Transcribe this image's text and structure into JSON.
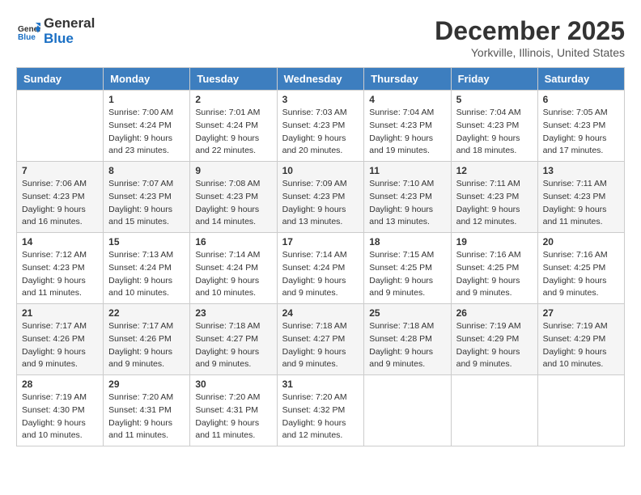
{
  "header": {
    "logo_general": "General",
    "logo_blue": "Blue",
    "month_title": "December 2025",
    "location": "Yorkville, Illinois, United States"
  },
  "columns": [
    "Sunday",
    "Monday",
    "Tuesday",
    "Wednesday",
    "Thursday",
    "Friday",
    "Saturday"
  ],
  "weeks": [
    [
      {
        "day": "",
        "info": ""
      },
      {
        "day": "1",
        "info": "Sunrise: 7:00 AM\nSunset: 4:24 PM\nDaylight: 9 hours\nand 23 minutes."
      },
      {
        "day": "2",
        "info": "Sunrise: 7:01 AM\nSunset: 4:24 PM\nDaylight: 9 hours\nand 22 minutes."
      },
      {
        "day": "3",
        "info": "Sunrise: 7:03 AM\nSunset: 4:23 PM\nDaylight: 9 hours\nand 20 minutes."
      },
      {
        "day": "4",
        "info": "Sunrise: 7:04 AM\nSunset: 4:23 PM\nDaylight: 9 hours\nand 19 minutes."
      },
      {
        "day": "5",
        "info": "Sunrise: 7:04 AM\nSunset: 4:23 PM\nDaylight: 9 hours\nand 18 minutes."
      },
      {
        "day": "6",
        "info": "Sunrise: 7:05 AM\nSunset: 4:23 PM\nDaylight: 9 hours\nand 17 minutes."
      }
    ],
    [
      {
        "day": "7",
        "info": "Sunrise: 7:06 AM\nSunset: 4:23 PM\nDaylight: 9 hours\nand 16 minutes."
      },
      {
        "day": "8",
        "info": "Sunrise: 7:07 AM\nSunset: 4:23 PM\nDaylight: 9 hours\nand 15 minutes."
      },
      {
        "day": "9",
        "info": "Sunrise: 7:08 AM\nSunset: 4:23 PM\nDaylight: 9 hours\nand 14 minutes."
      },
      {
        "day": "10",
        "info": "Sunrise: 7:09 AM\nSunset: 4:23 PM\nDaylight: 9 hours\nand 13 minutes."
      },
      {
        "day": "11",
        "info": "Sunrise: 7:10 AM\nSunset: 4:23 PM\nDaylight: 9 hours\nand 13 minutes."
      },
      {
        "day": "12",
        "info": "Sunrise: 7:11 AM\nSunset: 4:23 PM\nDaylight: 9 hours\nand 12 minutes."
      },
      {
        "day": "13",
        "info": "Sunrise: 7:11 AM\nSunset: 4:23 PM\nDaylight: 9 hours\nand 11 minutes."
      }
    ],
    [
      {
        "day": "14",
        "info": "Sunrise: 7:12 AM\nSunset: 4:23 PM\nDaylight: 9 hours\nand 11 minutes."
      },
      {
        "day": "15",
        "info": "Sunrise: 7:13 AM\nSunset: 4:24 PM\nDaylight: 9 hours\nand 10 minutes."
      },
      {
        "day": "16",
        "info": "Sunrise: 7:14 AM\nSunset: 4:24 PM\nDaylight: 9 hours\nand 10 minutes."
      },
      {
        "day": "17",
        "info": "Sunrise: 7:14 AM\nSunset: 4:24 PM\nDaylight: 9 hours\nand 9 minutes."
      },
      {
        "day": "18",
        "info": "Sunrise: 7:15 AM\nSunset: 4:25 PM\nDaylight: 9 hours\nand 9 minutes."
      },
      {
        "day": "19",
        "info": "Sunrise: 7:16 AM\nSunset: 4:25 PM\nDaylight: 9 hours\nand 9 minutes."
      },
      {
        "day": "20",
        "info": "Sunrise: 7:16 AM\nSunset: 4:25 PM\nDaylight: 9 hours\nand 9 minutes."
      }
    ],
    [
      {
        "day": "21",
        "info": "Sunrise: 7:17 AM\nSunset: 4:26 PM\nDaylight: 9 hours\nand 9 minutes."
      },
      {
        "day": "22",
        "info": "Sunrise: 7:17 AM\nSunset: 4:26 PM\nDaylight: 9 hours\nand 9 minutes."
      },
      {
        "day": "23",
        "info": "Sunrise: 7:18 AM\nSunset: 4:27 PM\nDaylight: 9 hours\nand 9 minutes."
      },
      {
        "day": "24",
        "info": "Sunrise: 7:18 AM\nSunset: 4:27 PM\nDaylight: 9 hours\nand 9 minutes."
      },
      {
        "day": "25",
        "info": "Sunrise: 7:18 AM\nSunset: 4:28 PM\nDaylight: 9 hours\nand 9 minutes."
      },
      {
        "day": "26",
        "info": "Sunrise: 7:19 AM\nSunset: 4:29 PM\nDaylight: 9 hours\nand 9 minutes."
      },
      {
        "day": "27",
        "info": "Sunrise: 7:19 AM\nSunset: 4:29 PM\nDaylight: 9 hours\nand 10 minutes."
      }
    ],
    [
      {
        "day": "28",
        "info": "Sunrise: 7:19 AM\nSunset: 4:30 PM\nDaylight: 9 hours\nand 10 minutes."
      },
      {
        "day": "29",
        "info": "Sunrise: 7:20 AM\nSunset: 4:31 PM\nDaylight: 9 hours\nand 11 minutes."
      },
      {
        "day": "30",
        "info": "Sunrise: 7:20 AM\nSunset: 4:31 PM\nDaylight: 9 hours\nand 11 minutes."
      },
      {
        "day": "31",
        "info": "Sunrise: 7:20 AM\nSunset: 4:32 PM\nDaylight: 9 hours\nand 12 minutes."
      },
      {
        "day": "",
        "info": ""
      },
      {
        "day": "",
        "info": ""
      },
      {
        "day": "",
        "info": ""
      }
    ]
  ]
}
